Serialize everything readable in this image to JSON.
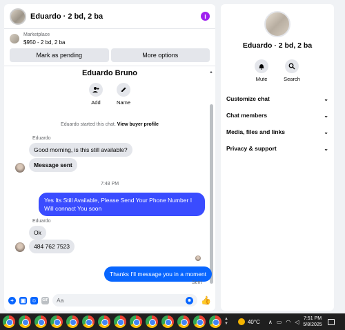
{
  "chat": {
    "title": "Eduardo · 2 bd, 2 ba",
    "listing_label": "Marketplace",
    "listing_price": "$950 - 2 bd, 2 ba",
    "mark_pending": "Mark as pending",
    "more_options": "More options",
    "profile_name": "Eduardo Bruno",
    "add_label": "Add",
    "name_label": "Name",
    "started_note": "Eduardo started this chat.",
    "view_profile": "View buyer profile",
    "messages": [
      {
        "sender": "Eduardo",
        "text": "Good morning, is this still available?"
      },
      {
        "text": "Message sent"
      },
      {
        "time": "7:48 PM"
      },
      {
        "text": "Yes Its Still Available, Please Send Your Phone Number I Will connact You soon"
      },
      {
        "sender": "Eduardo",
        "text": "Ok"
      },
      {
        "text": "484 762 7523"
      },
      {
        "text": "Thanks I'll message you in a moment"
      }
    ],
    "sent_status": "Sent",
    "input_placeholder": "Aa"
  },
  "side": {
    "title": "Eduardo · 2 bd, 2 ba",
    "mute": "Mute",
    "search": "Search",
    "menu": [
      "Customize chat",
      "Chat members",
      "Media, files and links",
      "Privacy & support"
    ]
  },
  "taskbar": {
    "temperature": "40°C",
    "time": "7:51 PM",
    "date": "5/8/2025"
  },
  "colors": {
    "accent": "#3a4cff",
    "blue": "#0866ff",
    "info": "#a020f0"
  }
}
